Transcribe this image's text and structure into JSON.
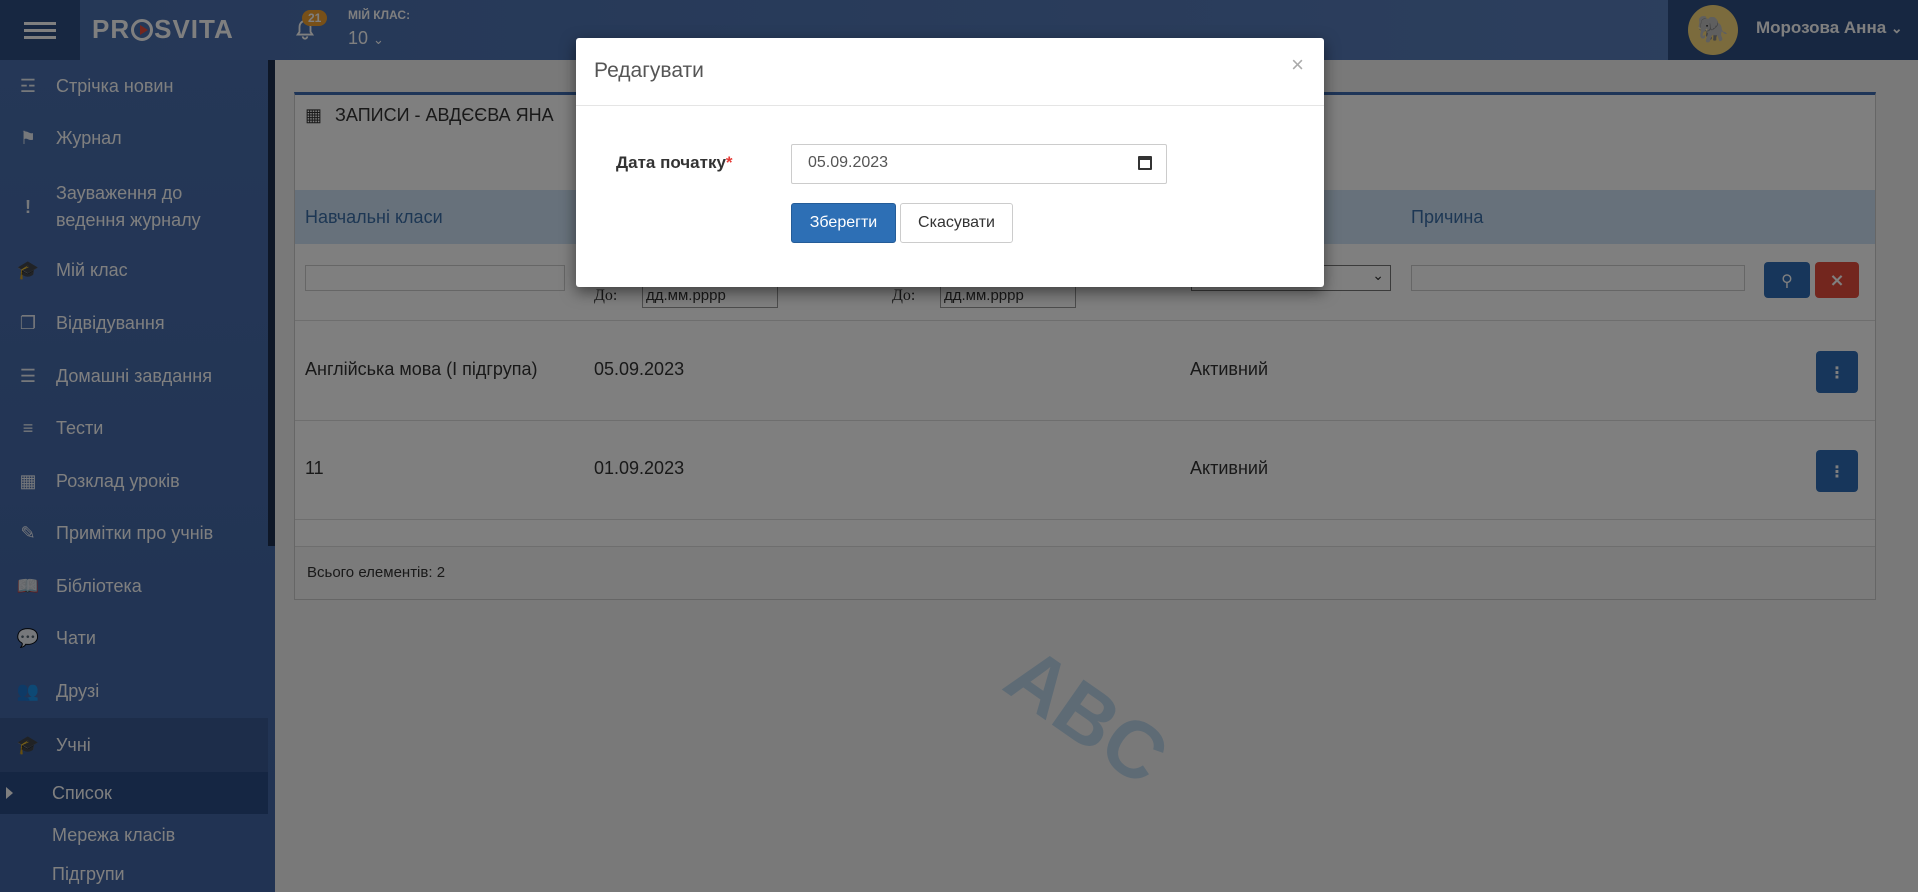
{
  "header": {
    "logo": "PRSVITA",
    "notification_count": "21",
    "my_class_label": "МІЙ КЛАС:",
    "my_class_value": "10",
    "user_name": "Морозова Анна"
  },
  "sidebar": {
    "items": [
      {
        "label": "Стрічка новин",
        "icon": "rss-icon"
      },
      {
        "label": "Журнал",
        "icon": "bookmark-icon"
      },
      {
        "label": "Зауваження до",
        "label2": "ведення журналу",
        "icon": "exclamation-icon"
      },
      {
        "label": "Мій клас",
        "icon": "graduation-cap-icon"
      },
      {
        "label": "Відвідування",
        "icon": "copy-icon"
      },
      {
        "label": "Домашні завдання",
        "icon": "tasks-icon"
      },
      {
        "label": "Тести",
        "icon": "indent-icon"
      },
      {
        "label": "Розклад уроків",
        "icon": "calendar-icon"
      },
      {
        "label": "Примітки про учнів",
        "icon": "note-icon"
      },
      {
        "label": "Бібліотека",
        "icon": "book-icon"
      },
      {
        "label": "Чати",
        "icon": "chat-icon"
      },
      {
        "label": "Друзі",
        "icon": "users-icon"
      },
      {
        "label": "Учні",
        "icon": "graduation-cap-icon"
      }
    ],
    "sub_items": [
      {
        "label": "Список"
      },
      {
        "label": "Мережа класів"
      },
      {
        "label": "Підгрупи"
      }
    ]
  },
  "panel": {
    "title": "ЗАПИСИ - АВДЄЄВА ЯНА",
    "columns": [
      "Навчальні класи",
      "Причина"
    ],
    "filter_to_label": "До:",
    "date_placeholder": "дд.мм.рррр",
    "rows": [
      {
        "class": "Англійська мова (І підгрупа)",
        "date": "05.09.2023",
        "status": "Активний"
      },
      {
        "class": "11",
        "date": "01.09.2023",
        "status": "Активний"
      }
    ],
    "total": "Всього елементів: 2"
  },
  "modal": {
    "title": "Редагувати",
    "close": "×",
    "field_label": "Дата початку",
    "required_mark": "*",
    "date_value": "05.09.2023",
    "save_label": "Зберегти",
    "cancel_label": "Скасувати"
  },
  "colors": {
    "primary": "#2d6fb5",
    "sidebar": "#4a6fae",
    "danger": "#e74c3c",
    "table_header": "#cfe3f6"
  }
}
